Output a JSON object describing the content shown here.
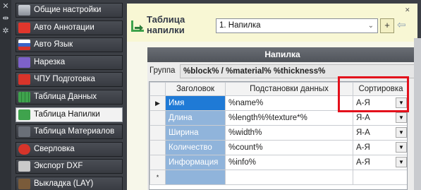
{
  "sidebar": {
    "items": [
      {
        "label": "Общие настройки",
        "icon": "settings-bar-icon",
        "color": "#8a8f98"
      },
      {
        "label": "Авто Аннотации",
        "icon": "car-icon",
        "color": "#e0362c"
      },
      {
        "label": "Авто Язык",
        "icon": "flag-icon",
        "color": "#3a63c8"
      },
      {
        "label": "Нарезка",
        "icon": "cut-icon",
        "color": "#7d61c9"
      },
      {
        "label": "ЧПУ Подготовка",
        "icon": "cnc-icon",
        "color": "#d8342a"
      },
      {
        "label": "Таблица Данных",
        "icon": "table-icon",
        "color": "#3fa34d"
      },
      {
        "label": "Таблица Напилки",
        "icon": "weld-table-icon",
        "color": "#3fa34d",
        "active": true
      },
      {
        "label": "Таблица Материалов",
        "icon": "materials-icon",
        "color": "#6a6f78"
      },
      {
        "label": "Сверловка",
        "icon": "drill-icon",
        "color": "#d6342a"
      },
      {
        "label": "Экспорт DXF",
        "icon": "dxf-icon",
        "color": "#c9c9c9"
      },
      {
        "label": "Выкладка (LAY)",
        "icon": "layout-icon",
        "color": "#7a5b3a"
      }
    ]
  },
  "header": {
    "title": "Таблица напилки",
    "combo_value": "1. Напилка",
    "add_label": "+"
  },
  "panel": {
    "title": "Напилка",
    "group_label": "Группа",
    "group_value": "%block% / %material% %thickness%",
    "columns": [
      "Заголовок",
      "Подстановки данных",
      "Сортировка"
    ],
    "rows": [
      {
        "name": "Имя",
        "sub": "%name%",
        "sort": "А-Я",
        "marker": "▶"
      },
      {
        "name": "Длина",
        "sub": "%length%%texture*%",
        "sort": "Я-А",
        "marker": ""
      },
      {
        "name": "Ширина",
        "sub": "%width%",
        "sort": "Я-А",
        "marker": ""
      },
      {
        "name": "Количество",
        "sub": "%count%",
        "sort": "А-Я",
        "marker": ""
      },
      {
        "name": "Информация",
        "sub": "%info%",
        "sort": "А-Я",
        "marker": ""
      }
    ],
    "new_row_marker": "*"
  },
  "colors": {
    "accent": "#1f7ad6",
    "highlight": "#e3101b",
    "header_bg": "#f8f7d4"
  }
}
